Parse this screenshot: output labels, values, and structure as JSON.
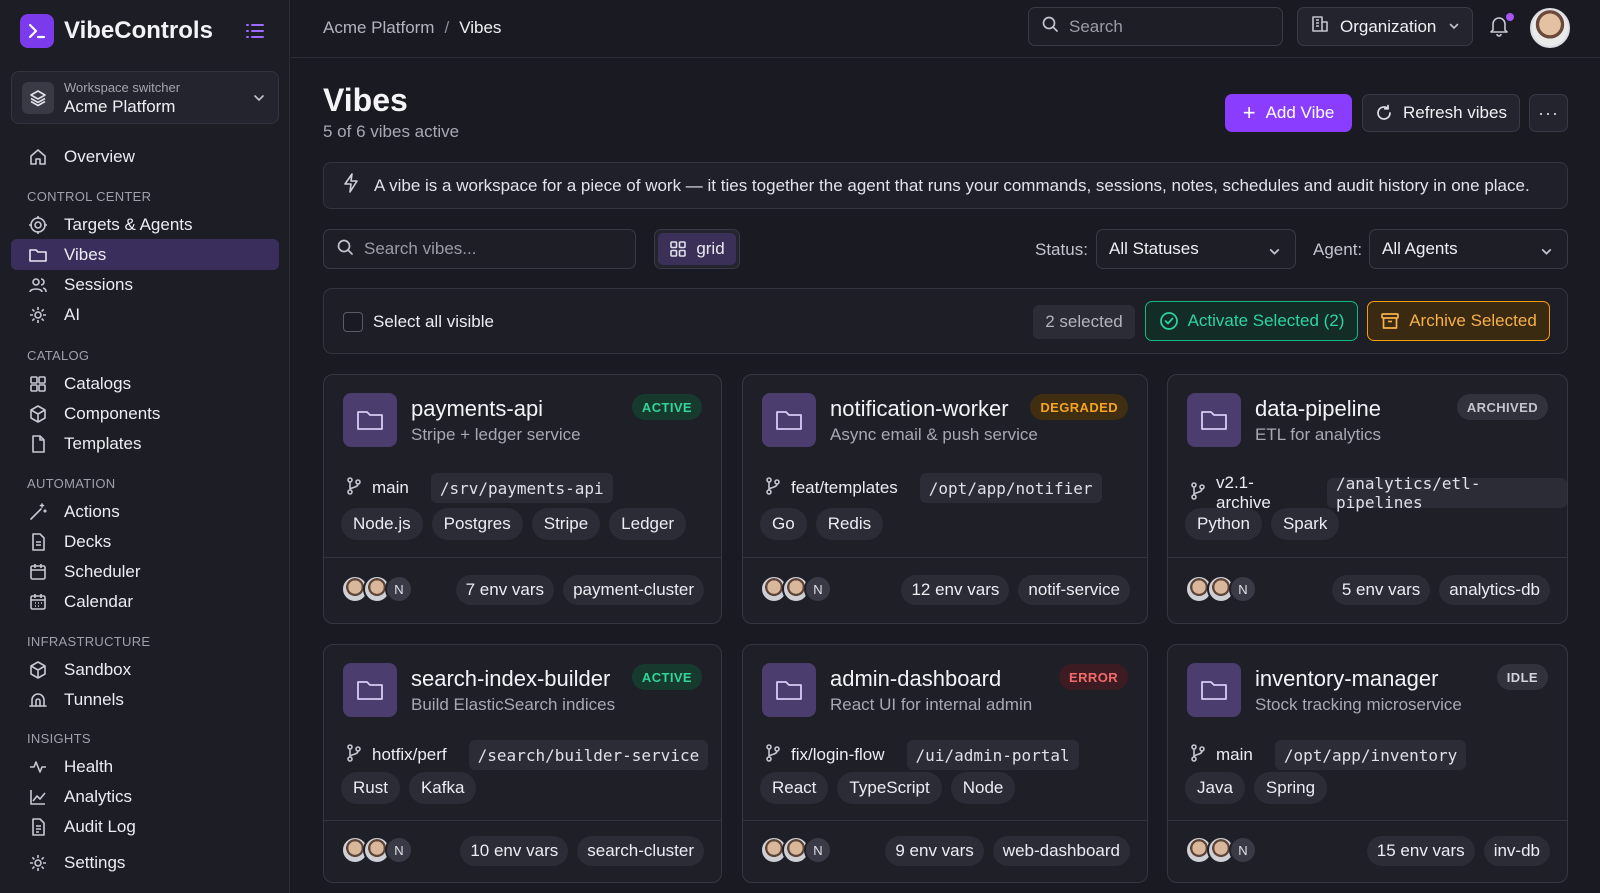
{
  "brand": {
    "name": "VibeControls",
    "logo_glyph": ">_",
    "accent": "#7c3aed"
  },
  "workspace": {
    "caption": "Workspace switcher",
    "name": "Acme Platform"
  },
  "nav": {
    "overview": "Overview",
    "sections": {
      "control_center": "CONTROL CENTER",
      "catalog": "CATALOG",
      "automation": "AUTOMATION",
      "infrastructure": "INFRASTRUCTURE",
      "insights": "INSIGHTS"
    },
    "items": {
      "targets": "Targets & Agents",
      "vibes": "Vibes",
      "sessions": "Sessions",
      "ai": "AI",
      "catalogs": "Catalogs",
      "components": "Components",
      "templates": "Templates",
      "actions": "Actions",
      "decks": "Decks",
      "scheduler": "Scheduler",
      "calendar": "Calendar",
      "sandbox": "Sandbox",
      "tunnels": "Tunnels",
      "health": "Health",
      "analytics": "Analytics",
      "audit_log": "Audit Log",
      "settings": "Settings"
    }
  },
  "topbar": {
    "breadcrumb": [
      "Acme Platform",
      "Vibes"
    ],
    "breadcrumb_sep": "/",
    "search_placeholder": "Search",
    "org_label": "Organization"
  },
  "header": {
    "title": "Vibes",
    "subtitle": "5 of 6 vibes active",
    "add_label": "Add Vibe",
    "refresh_label": "Refresh vibes",
    "more_label": "···"
  },
  "banner": {
    "text": "A vibe is a workspace for a piece of work — it ties together the agent that runs your commands, sessions, notes, schedules and audit history in one place."
  },
  "filters": {
    "search_placeholder": "Search vibes...",
    "view_label": "grid",
    "status_label": "Status:",
    "status_value": "All Statuses",
    "agent_label": "Agent:",
    "agent_value": "All Agents"
  },
  "bulk": {
    "select_all_label": "Select all visible",
    "selected_count": "2 selected",
    "activate_label": "Activate Selected (2)",
    "archive_label": "Archive Selected"
  },
  "cards": [
    {
      "name": "payments-api",
      "desc": "Stripe + ledger service",
      "status": "ACTIVE",
      "status_kind": "active",
      "branch": "main",
      "path": "/srv/payments-api",
      "tags": [
        "Node.js",
        "Postgres",
        "Stripe",
        "Ledger"
      ],
      "avatar_initial": "N",
      "env": "7 env vars",
      "target": "payment-cluster"
    },
    {
      "name": "notification-worker",
      "desc": "Async email & push service",
      "status": "DEGRADED",
      "status_kind": "degraded",
      "branch": "feat/templates",
      "path": "/opt/app/notifier",
      "tags": [
        "Go",
        "Redis"
      ],
      "avatar_initial": "N",
      "env": "12 env vars",
      "target": "notif-service"
    },
    {
      "name": "data-pipeline",
      "desc": "ETL for analytics",
      "status": "ARCHIVED",
      "status_kind": "archived",
      "branch": "v2.1-archive",
      "path": "/analytics/etl-pipelines",
      "tags": [
        "Python",
        "Spark"
      ],
      "avatar_initial": "N",
      "env": "5 env vars",
      "target": "analytics-db"
    },
    {
      "name": "search-index-builder",
      "desc": "Build ElasticSearch indices",
      "status": "ACTIVE",
      "status_kind": "active",
      "branch": "hotfix/perf",
      "path": "/search/builder-service",
      "tags": [
        "Rust",
        "Kafka"
      ],
      "avatar_initial": "N",
      "env": "10 env vars",
      "target": "search-cluster"
    },
    {
      "name": "admin-dashboard",
      "desc": "React UI for internal admin",
      "status": "ERROR",
      "status_kind": "error",
      "branch": "fix/login-flow",
      "path": "/ui/admin-portal",
      "tags": [
        "React",
        "TypeScript",
        "Node"
      ],
      "avatar_initial": "N",
      "env": "9 env vars",
      "target": "web-dashboard"
    },
    {
      "name": "inventory-manager",
      "desc": "Stock tracking microservice",
      "status": "IDLE",
      "status_kind": "idle",
      "branch": "main",
      "path": "/opt/app/inventory",
      "tags": [
        "Java",
        "Spring"
      ],
      "avatar_initial": "N",
      "env": "15 env vars",
      "target": "inv-db"
    }
  ]
}
